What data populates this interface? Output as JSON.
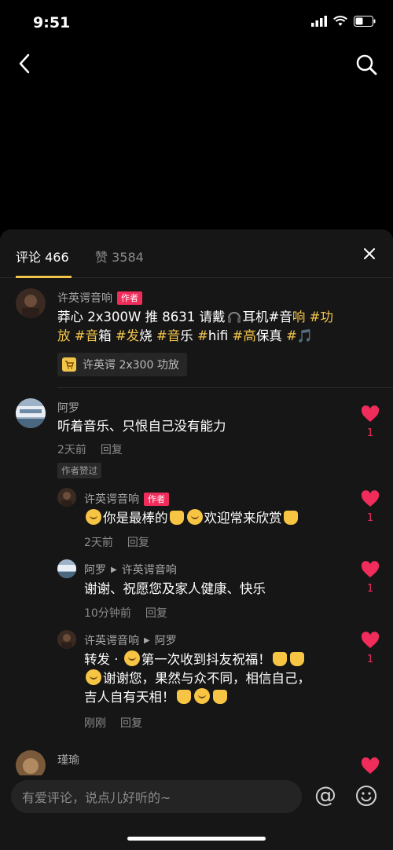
{
  "status_bar": {
    "time": "9:51"
  },
  "sheet": {
    "tabs": {
      "comments_label": "评论 466",
      "likes_label": "赞 3584"
    },
    "comments": [
      {
        "name": "许英谔音响",
        "author_tag": "作者",
        "text_line1_a": "莽心 2x300W 推 8631 请戴",
        "text_line1_b": "耳机#音",
        "text_line1_c": "响",
        "text_line1_d": " #功",
        "text_line2_a": "放",
        "text_line2_b": " #音",
        "text_line2_c": "箱",
        "text_line2_d": " #发",
        "text_line2_e": "烧",
        "text_line2_f": " #音",
        "text_line2_g": "乐",
        "text_line2_h": " #",
        "text_line2_i": "hifi",
        "text_line2_j": " #高",
        "text_line2_k": "保真",
        "text_line2_l": " #",
        "text_line2_m": "🎵",
        "product_label": "许英谔 2x300 功放"
      },
      {
        "name": "阿罗",
        "text": "听着音乐、只恨自己没有能力",
        "time": "2天前",
        "reply": "回复",
        "author_liked": "作者赞过",
        "likes": "1"
      }
    ],
    "replies": [
      {
        "name": "许英谔音响",
        "author_tag": "作者",
        "text_a": "你是最棒的",
        "text_b": "欢迎常来欣赏",
        "time": "2天前",
        "reply": "回复",
        "likes": "1"
      },
      {
        "name": "阿罗",
        "reply_to": "许英谔音响",
        "text": "谢谢、祝愿您及家人健康、快乐",
        "time": "10分钟前",
        "reply": "回复",
        "likes": "1"
      },
      {
        "name": "许英谔音响",
        "reply_to": "阿罗",
        "text_line1_a": "转发 · ",
        "text_line1_b": "第一次收到抖友祝福！",
        "text_line2": "谢谢您，果然与众不同，相信自己，",
        "text_line3": "吉人自有天相！",
        "time": "刚刚",
        "reply": "回复",
        "likes": "1"
      }
    ],
    "next_comment": {
      "name": "瑾瑜"
    },
    "input": {
      "placeholder": "有爱评论，说点儿好听的~",
      "at_symbol": "@"
    }
  },
  "colors": {
    "accent_yellow": "#f3c44a",
    "like_red": "#f02c5b",
    "sheet_bg": "#161616"
  }
}
